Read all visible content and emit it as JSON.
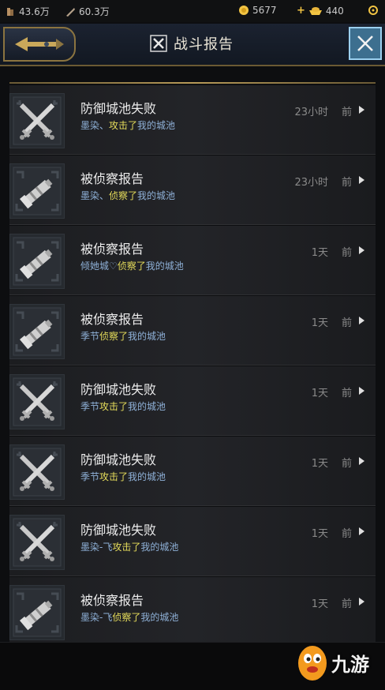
{
  "status": {
    "wood": "43.6万",
    "iron": "60.3万",
    "gold": "5677",
    "gem": "440"
  },
  "header": {
    "title": "战斗报告"
  },
  "reports": [
    {
      "type": "swords",
      "title": "防御城池失败",
      "actor": "墨染、",
      "action": "攻击了",
      "target": "我的城池",
      "time": "23小时",
      "ago": "前"
    },
    {
      "type": "scope",
      "title": "被侦察报告",
      "actor": "墨染、",
      "action": "侦察了",
      "target": "我的城池",
      "time": "23小时",
      "ago": "前"
    },
    {
      "type": "scope",
      "title": "被侦察报告",
      "actor": "倾她城♡",
      "action": "侦察了",
      "target": "我的城池",
      "time": "1天",
      "ago": "前"
    },
    {
      "type": "scope",
      "title": "被侦察报告",
      "actor": "季节",
      "action": "侦察了",
      "target": "我的城池",
      "time": "1天",
      "ago": "前"
    },
    {
      "type": "swords",
      "title": "防御城池失败",
      "actor": "季节",
      "action": "攻击了",
      "target": "我的城池",
      "time": "1天",
      "ago": "前"
    },
    {
      "type": "swords",
      "title": "防御城池失败",
      "actor": "季节",
      "action": "攻击了",
      "target": "我的城池",
      "time": "1天",
      "ago": "前"
    },
    {
      "type": "swords",
      "title": "防御城池失败",
      "actor": "墨染-飞",
      "action": "攻击了",
      "target": "我的城池",
      "time": "1天",
      "ago": "前"
    },
    {
      "type": "scope",
      "title": "被侦察报告",
      "actor": "墨染-飞",
      "action": "侦察了",
      "target": "我的城池",
      "time": "1天",
      "ago": "前"
    }
  ],
  "watermark": {
    "text": "九游"
  },
  "colors": {
    "accent": "#8b7440",
    "action": "#e6dd5b",
    "actor": "#8fb1d8",
    "close": "#3d6f8f"
  }
}
